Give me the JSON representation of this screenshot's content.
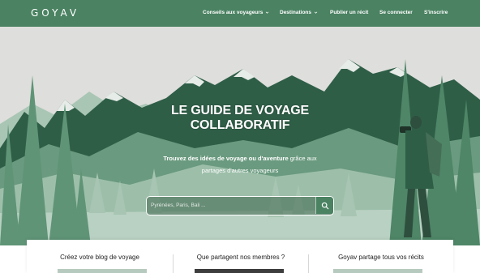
{
  "header": {
    "logo": "GOYAV",
    "nav": [
      {
        "label": "Conseils aux voyageurs",
        "dropdown": true
      },
      {
        "label": "Destinations",
        "dropdown": true
      },
      {
        "label": "Publier un récit",
        "dropdown": false
      },
      {
        "label": "Se connecter",
        "dropdown": false
      },
      {
        "label": "S'inscrire",
        "dropdown": false
      }
    ]
  },
  "hero": {
    "title_line1": "LE GUIDE DE VOYAGE",
    "title_line2": "COLLABORATIF",
    "subtitle_bold": "Trouvez des idées de voyage ou d'aventure",
    "subtitle_rest": " grâce aux",
    "subtitle_line2": "partages d'autres voyageurs"
  },
  "search": {
    "placeholder": "Pyrénées, Paris, Bali ...",
    "icon": "search-icon"
  },
  "cards": [
    {
      "title": "Créez votre blog de voyage"
    },
    {
      "title": "Que partagent nos membres ?"
    },
    {
      "title": "Goyav partage tous vos récits"
    }
  ],
  "colors": {
    "brand": "#4a8262",
    "sky": "#dcdcdc",
    "mountain_dark": "#2f5e47",
    "forest_light": "#8fb8a0"
  }
}
